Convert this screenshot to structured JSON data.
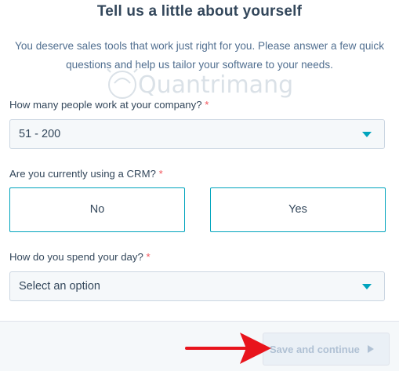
{
  "header": {
    "title": "Tell us a little about yourself",
    "subtitle": "You deserve sales tools that work just right for you. Please answer a few quick questions and help us tailor your software to your needs."
  },
  "watermark": {
    "text": "Quantrimang"
  },
  "form": {
    "company_size": {
      "label": "How many people work at your company?",
      "required_mark": "*",
      "selected": "51 - 200"
    },
    "crm": {
      "label": "Are you currently using a CRM?",
      "required_mark": "*",
      "options": [
        "No",
        "Yes"
      ]
    },
    "day": {
      "label": "How do you spend your day?",
      "required_mark": "*",
      "selected": "Select an option"
    }
  },
  "footer": {
    "save_label": "Save and continue"
  },
  "colors": {
    "accent": "#00a4bd",
    "required": "#f2545b",
    "arrow": "#e8141c",
    "text": "#33475b"
  }
}
